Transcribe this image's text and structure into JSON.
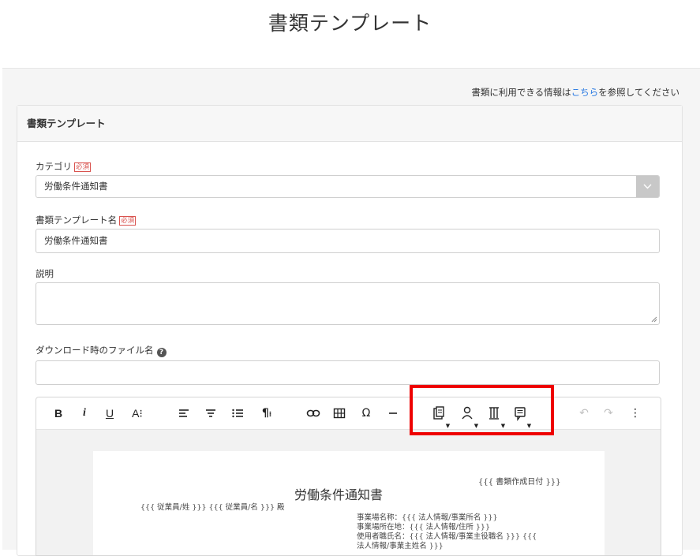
{
  "page": {
    "title": "書類テンプレート"
  },
  "info": {
    "prefix": "書類に利用できる情報は",
    "link": "こちら",
    "suffix": "を参照してください"
  },
  "card": {
    "title": "書類テンプレート"
  },
  "form": {
    "required_badge": "必須",
    "category": {
      "label": "カテゴリ",
      "value": "労働条件通知書"
    },
    "template_name": {
      "label": "書類テンプレート名",
      "value": "労働条件通知書"
    },
    "description": {
      "label": "説明",
      "value": ""
    },
    "download_filename": {
      "label": "ダウンロード時のファイル名",
      "value": ""
    }
  },
  "toolbar": {
    "bold": "B",
    "italic": "i",
    "underline": "U",
    "font_size": "A⁝",
    "align": "☰",
    "undo": "↶",
    "redo": "↷",
    "more": "⋮"
  },
  "document": {
    "date": "{{{ 書類作成日付 }}}",
    "title": "労働条件通知書",
    "addressee": "{{{ 従業員/姓 }}}  {{{ 従業員/名 }}}  殿",
    "lines": [
      "事業場名称：{{{ 法人情報/事業所名 }}}",
      "事業場所在地：{{{ 法人情報/住所 }}}",
      "使用者職氏名：{{{ 法人情報/事業主役職名 }}} {{{",
      "法人情報/事業主姓名 }}}"
    ]
  },
  "colors": {
    "link": "#2a7ae2",
    "required": "#d9534f",
    "highlight": "#ee0000"
  }
}
